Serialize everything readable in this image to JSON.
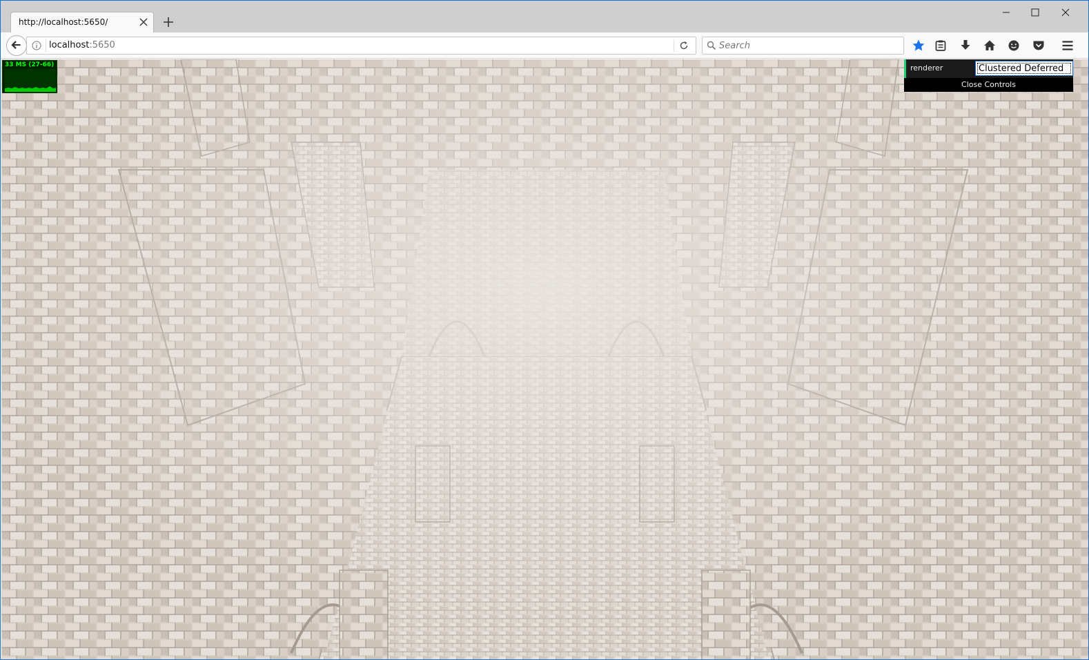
{
  "tab": {
    "title": "http://localhost:5650/"
  },
  "urlbar": {
    "host": "localhost",
    "port": ":5650"
  },
  "search": {
    "placeholder": "Search"
  },
  "toolbar": {
    "icons": [
      "bookmark-star-icon",
      "reading-list-icon",
      "download-icon",
      "home-icon",
      "feedback-icon",
      "pocket-icon",
      "menu-icon"
    ],
    "accent": "#1a73e8"
  },
  "stats": {
    "text": "33 MS (27-66)",
    "color": "#00ff00"
  },
  "gui": {
    "renderer_label": "renderer",
    "renderer_value": "Clustered Deferred",
    "close_label": "Close Controls",
    "accent": "#1ed36f"
  },
  "scene": {
    "colors": {
      "stone": "#d9d0c7",
      "mortar": "#b5aba2",
      "fog": "#e8e3df"
    }
  }
}
